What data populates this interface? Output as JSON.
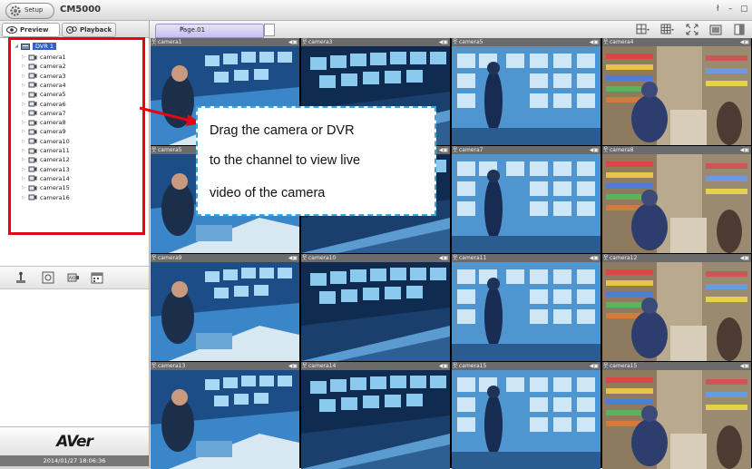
{
  "app": {
    "setup_label": "Setup",
    "title": "CM5000"
  },
  "tabs": [
    {
      "label": "Preview",
      "active": true
    },
    {
      "label": "Playback",
      "active": false
    }
  ],
  "tree": {
    "root": "DVR 1",
    "cameras": [
      "camera1",
      "camera2",
      "camera3",
      "camera4",
      "camera5",
      "camera6",
      "camera7",
      "camera8",
      "camera9",
      "camera10",
      "camera11",
      "camera12",
      "camera13",
      "camera14",
      "camera15",
      "camera16"
    ]
  },
  "page_tab": {
    "label": "Page.01"
  },
  "channels": [
    "camera1",
    "camera3",
    "camera5",
    "camera4",
    "camera5",
    "camera6",
    "camera7",
    "camera8",
    "camera9",
    "camera10",
    "camera11",
    "camera12",
    "camera13",
    "camera14",
    "camera15",
    "camera15"
  ],
  "callout": {
    "line1": "Drag the camera or DVR",
    "line2": "to the channel to view live",
    "line3": "video of the camera"
  },
  "footer": {
    "logo_brand": "AVer",
    "datetime": "2014/01/27 18:06:36"
  },
  "colors": {
    "highlight": "#e30613",
    "callout_border": "#35a9df",
    "tree_selected": "#3361c6"
  }
}
